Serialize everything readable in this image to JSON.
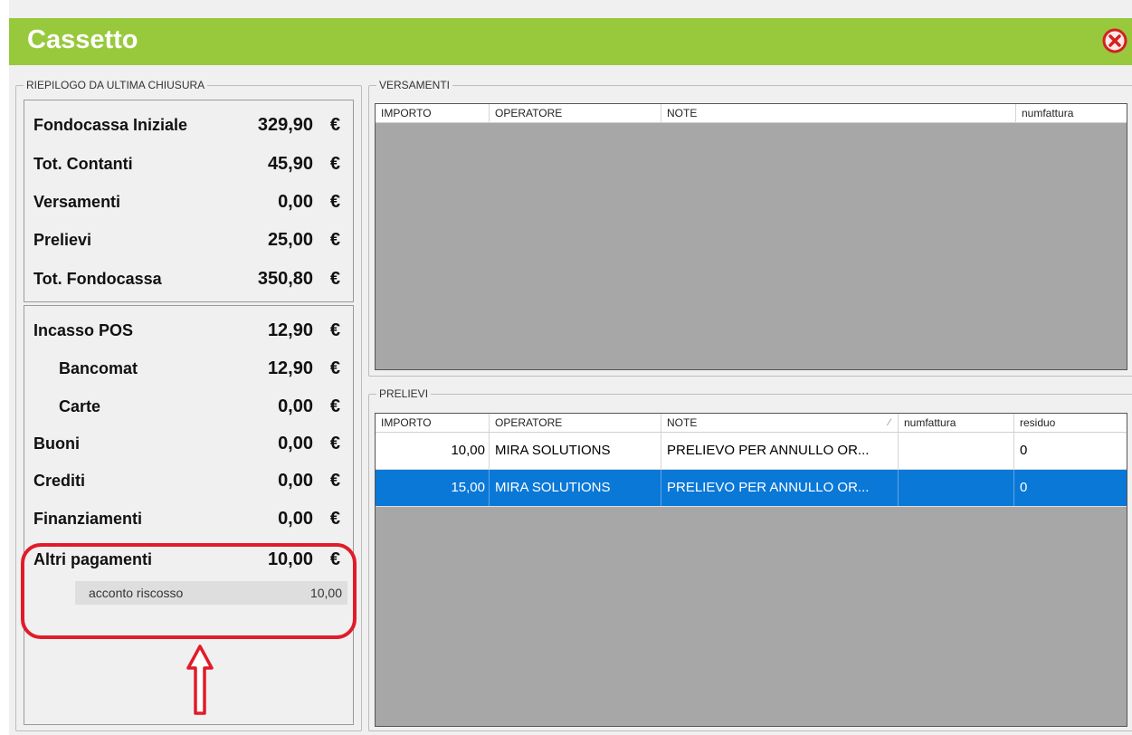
{
  "window": {
    "title": "Cassetto",
    "close_icon": "close-circle-icon",
    "accent": "#98c93c"
  },
  "summary": {
    "group_label": "RIEPILOGO DA ULTIMA CHIUSURA",
    "currency": "€",
    "top": [
      {
        "label": "Fondocassa Iniziale",
        "value": "329,90"
      },
      {
        "label": "Tot. Contanti",
        "value": "45,90"
      },
      {
        "label": "Versamenti",
        "value": "0,00"
      },
      {
        "label": "Prelievi",
        "value": "25,00"
      },
      {
        "label": "Tot. Fondocassa",
        "value": "350,80"
      }
    ],
    "bottom": [
      {
        "label": "Incasso POS",
        "value": "12,90"
      },
      {
        "label": "Bancomat",
        "value": "12,90"
      },
      {
        "label": "Carte",
        "value": "0,00"
      },
      {
        "label": "Buoni",
        "value": "0,00"
      },
      {
        "label": "Crediti",
        "value": "0,00"
      },
      {
        "label": "Finanziamenti",
        "value": "0,00"
      },
      {
        "label": "Altri pagamenti",
        "value": "10,00"
      }
    ],
    "sub_items": [
      {
        "label": "acconto riscosso",
        "value": "10,00"
      }
    ],
    "highlight_color": "#e01c2a"
  },
  "versamenti": {
    "group_label": "VERSAMENTI",
    "columns": [
      "IMPORTO",
      "OPERATORE",
      "NOTE",
      "numfattura"
    ],
    "rows": []
  },
  "prelievi": {
    "group_label": "PRELIEVI",
    "columns": [
      "IMPORTO",
      "OPERATORE",
      "NOTE",
      "numfattura",
      "residuo"
    ],
    "sort_indicator": "⁄",
    "rows": [
      {
        "importo": "10,00",
        "operatore": "MIRA SOLUTIONS",
        "note": "PRELIEVO PER ANNULLO OR...",
        "numfattura": "",
        "residuo": "0"
      },
      {
        "importo": "15,00",
        "operatore": "MIRA SOLUTIONS",
        "note": "PRELIEVO PER ANNULLO OR...",
        "numfattura": "",
        "residuo": "0",
        "selected": true
      }
    ],
    "selection_color": "#0a78d7"
  }
}
